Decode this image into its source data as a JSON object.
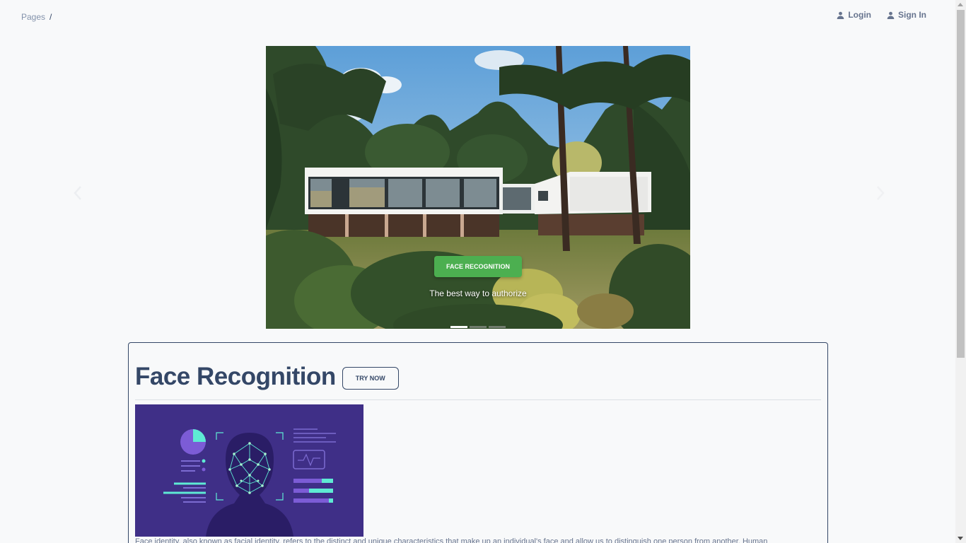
{
  "breadcrumb": {
    "root": "Pages",
    "separator": "/"
  },
  "nav": {
    "login_label": "Login",
    "signin_label": "Sign In",
    "login_icon": "user-icon",
    "signin_icon": "user-icon"
  },
  "carousel": {
    "badge_label": "FACE RECOGNITION",
    "subtitle": "The best way to authorize",
    "slide_count": 3,
    "active_slide": 1,
    "prev_icon": "chevron-left-icon",
    "next_icon": "chevron-right-icon"
  },
  "card": {
    "title": "Face Recognition",
    "try_label": "TRY NOW",
    "description": "Face identity, also known as facial identity, refers to the distinct and unique characteristics that make up an individual's face and allow us to distinguish one person from another. Human"
  },
  "colors": {
    "accent_green": "#4caf50",
    "primary_text": "#344767",
    "muted_text": "#67748e",
    "illustration_bg": "#3f2f87",
    "illustration_teal": "#2dd4bf"
  }
}
